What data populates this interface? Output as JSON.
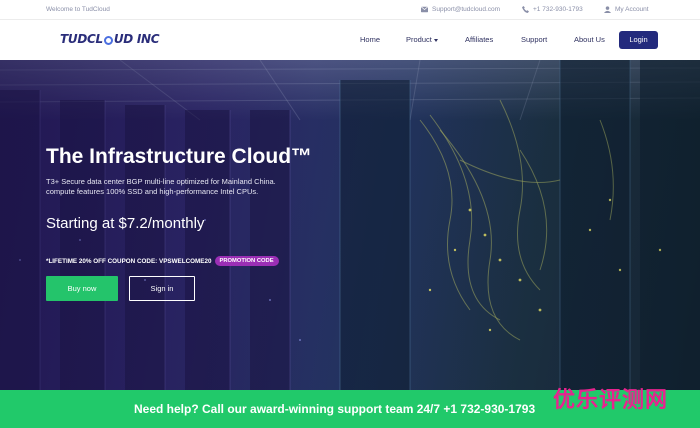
{
  "topbar": {
    "welcome": "Welcome to TudCloud",
    "email": "Support@tudcloud.com",
    "phone": "+1 732-930-1793",
    "account": "My Account"
  },
  "nav": {
    "logo": {
      "pre": "TUDCL",
      "post": "UD INC"
    },
    "items": [
      {
        "label": "Home"
      },
      {
        "label": "Product"
      },
      {
        "label": "Affiliates"
      },
      {
        "label": "Support"
      },
      {
        "label": "About Us"
      }
    ],
    "login_label": "Login"
  },
  "hero": {
    "title": "The Infrastructure Cloud™",
    "desc_line1": "T3+ Secure data center BGP multi-line optimized for Mainland China.",
    "desc_line2": "compute features 100% SSD and high-performance Intel CPUs.",
    "price": "Starting at $7.2/monthly",
    "coupon": "*LIFETIME 20% OFF COUPON CODE: VPSWELCOME20",
    "promo_badge": "PROMOTION CODE",
    "buy_label": "Buy now",
    "signin_label": "Sign in"
  },
  "support": {
    "text": "Need help? Call our award-winning support team 24/7 +1 732-930-1793"
  },
  "watermark": "优乐评测网",
  "colors": {
    "brand_navy": "#232a7d",
    "accent_green": "#24c46b",
    "promo_purple": "#9b2fb5",
    "watermark_pink": "#e8238f"
  },
  "icons": [
    "envelope-icon",
    "phone-icon",
    "user-icon",
    "chevron-down-icon"
  ]
}
